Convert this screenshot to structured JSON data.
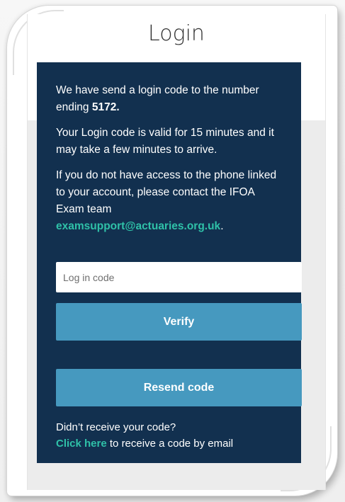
{
  "window": {
    "title": "Login"
  },
  "message": {
    "line1_prefix": "We have send a login code to the number ending ",
    "phone_suffix": "5172.",
    "line2": "Your Login code is valid for 15 minutes and it may take a few minutes to arrive.",
    "line3": "If you do not have access to the phone linked to your account, please contact the IFOA Exam team ",
    "support_email": "examsupport@actuaries.org.uk",
    "line3_end": "."
  },
  "form": {
    "code_placeholder": "Log in code",
    "code_value": "",
    "verify_label": "Verify",
    "resend_label": "Resend code"
  },
  "footer": {
    "question": "Didn’t receive your code?",
    "click_here": "Click here",
    "click_here_suffix": " to receive a code by email"
  },
  "colors": {
    "panel_bg": "#12304f",
    "button_bg": "#4699bf",
    "link_green": "#2fc1a8"
  }
}
